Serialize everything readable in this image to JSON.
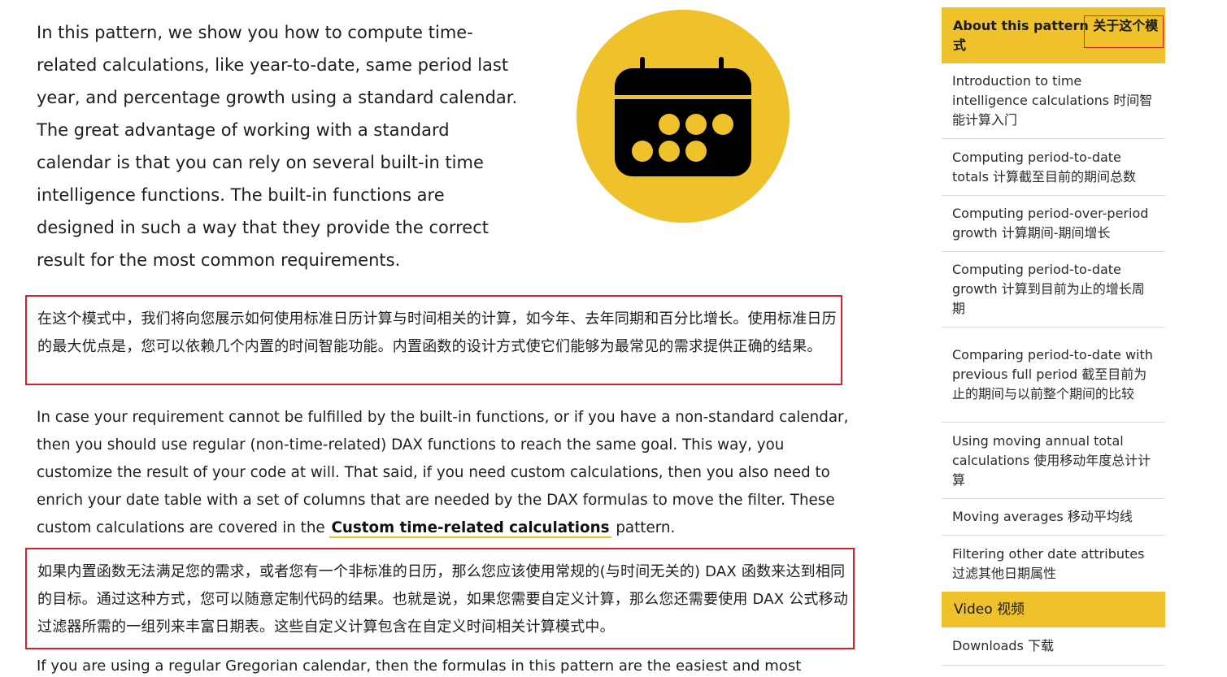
{
  "intro_text": "In this pattern, we show you how to compute time-related calculations, like year-to-date, same period last year, and percentage growth using a standard calendar. The great advantage of working with a standard calendar is that you can rely on several built-in time intelligence functions. The built-in functions are designed in such a way that they provide the correct result for the most common requirements.",
  "intro_translation": "在这个模式中，我们将向您展示如何使用标准日历计算与时间相关的计算，如今年、去年同期和百分比增长。使用标准日历的最大优点是，您可以依赖几个内置的时间智能功能。内置函数的设计方式使它们能够为最常见的需求提供正确的结果。",
  "para2": {
    "before_link": "In case your requirement cannot be fulfilled by the built-in functions, or if you have a non-standard calendar, then you should use regular (non-time-related) DAX functions to reach the same goal. This way, you customize the result of your code at will. That said, if you need custom calculations, then you also need to enrich your date table with a set of columns that are needed by the DAX formulas to move the filter. These custom calculations are covered in the ",
    "link_text": "Custom time-related calculations",
    "after_link": " pattern."
  },
  "para2_translation": "如果内置函数无法满足您的需求，或者您有一个非标准的日历，那么您应该使用常规的(与时间无关的) DAX 函数来达到相同的目标。通过这种方式，您可以随意定制代码的结果。也就是说，如果您需要自定义计算，那么您还需要使用 DAX 公式移动过滤器所需的一组列来丰富日期表。这些自定义计算包含在自定义时间相关计算模式中。",
  "cut_line": "If you are using a regular Gregorian calendar, then the formulas in this pattern are the easiest and most",
  "calendar_icon": "calendar-icon",
  "accent_color": "#efc12b",
  "highlight_border_color": "#d3202a",
  "sidebar": {
    "header": "About this pattern 关于这个模式",
    "items": [
      "Introduction to time intelligence calculations 时间智能计算入门",
      "Computing period-to-date totals 计算截至目前的期间总数",
      "Computing period-over-period growth 计算期间-期间增长",
      "Computing period-to-date growth 计算到目前为止的增长周期",
      "Comparing period-to-date with previous full period 截至目前为止的期间与以前整个期间的比较",
      "Using moving annual total calculations 使用移动年度总计计算",
      "Moving averages 移动平均线",
      "Filtering other date attributes 过滤其他日期属性"
    ],
    "video": "Video 视频",
    "downloads": "Downloads 下载"
  }
}
